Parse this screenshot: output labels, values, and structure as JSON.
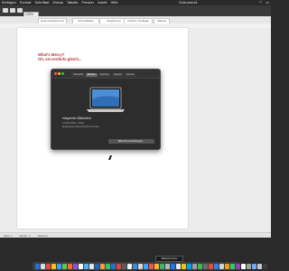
{
  "menubar": {
    "items": [
      "Einfügen",
      "Format",
      "Schriftart",
      "Extras",
      "Tabelle",
      "Fenster",
      "Arbeit",
      "Hilfe"
    ],
    "window_title": "Dokument1"
  },
  "toolbar": {
    "zoom": "125%"
  },
  "ribbon": {
    "buttons": [
      "Dokumentelemente",
      "Schnellbilder",
      "Diagramme",
      "Ansicht / Vorlagen",
      "Makros"
    ]
  },
  "document": {
    "line1": "What's Mercy?",
    "line2": "Oh, sei erst/Info gleich..."
  },
  "dialog": {
    "tabs": [
      "Übersicht",
      "Monitor",
      "Speicher",
      "Support",
      "Service"
    ],
    "active_tab": 0,
    "model": "Integrierter Bildschirm",
    "details": [
      "13-Zoll (2560 × 1600)",
      "Eingebauter Retina-Monitor (13 Zoll)"
    ],
    "button": "Bildschirmeinstellungen..."
  },
  "statusbar": {
    "items": [
      "Seite 1",
      "Wörter: 0",
      "Deutsch"
    ]
  },
  "tooltip": "Bildschirmfoto",
  "colors": {
    "heading": "#b5373a",
    "dialog_bg": "#2d2d2d",
    "dock_colors": [
      "#1e73d8",
      "#dcdcdc",
      "#e04a3a",
      "#f0c419",
      "#3b9dfc",
      "#5ac85a",
      "#ff6a2a",
      "#8a55d4",
      "#ffffff",
      "#4bb3fd",
      "#e6e6e6",
      "#1a66c2",
      "#f2a03d",
      "#3ac26b",
      "#2470d6",
      "#d9473d",
      "#5e5e5e",
      "#f5f5f5",
      "#3c8be6",
      "#d8d8d8",
      "#48a0f7",
      "#ef5350",
      "#f7b731",
      "#3ab56d",
      "#b7b7b7",
      "#1877f2",
      "#eaeaea",
      "#f1c40f",
      "#00a2ff",
      "#9aa0a6",
      "#3fb950",
      "#6c6c6c",
      "#e74c3c",
      "#2f80ed",
      "#d4d4d4",
      "#f39c12",
      "#2ecc71",
      "#8e44ad",
      "#ffffff",
      "#a0a0a0",
      "#6aaaff",
      "#c8c8c8",
      "#3e3e3e"
    ]
  }
}
